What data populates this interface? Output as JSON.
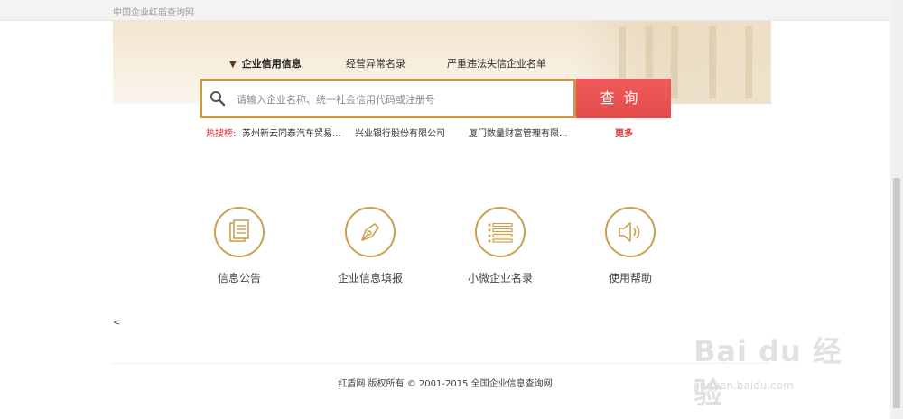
{
  "header": {
    "site_name": "中国企业红盾查询网"
  },
  "tabs": [
    {
      "label": "企业信用信息",
      "active": true
    },
    {
      "label": "经营异常名录",
      "active": false
    },
    {
      "label": "严重违法失信企业名单",
      "active": false
    }
  ],
  "search": {
    "placeholder": "请输入企业名称、统一社会信用代码或注册号",
    "value": "",
    "button_label": "查询"
  },
  "hot": {
    "label": "热搜榜:",
    "items": [
      "苏州新云同泰汽车贸易...",
      "兴业银行股份有限公司",
      "厦门数量财富管理有限..."
    ],
    "more_label": "更多"
  },
  "features": [
    {
      "label": "信息公告",
      "icon": "document-icon"
    },
    {
      "label": "企业信息填报",
      "icon": "pen-icon"
    },
    {
      "label": "小微企业名录",
      "icon": "list-icon"
    },
    {
      "label": "使用帮助",
      "icon": "speaker-icon"
    }
  ],
  "misc": {
    "lt": "<"
  },
  "footer": {
    "text": "红盾网 版权所有 © 2001-2015  全国企业信息查询网"
  },
  "watermark": {
    "brand": "Bai du 经验",
    "url": "jingyan.baidu.com"
  },
  "colors": {
    "accent_gold": "#c79a4b",
    "button_red": "#e95252",
    "hot_red": "#d33333"
  }
}
